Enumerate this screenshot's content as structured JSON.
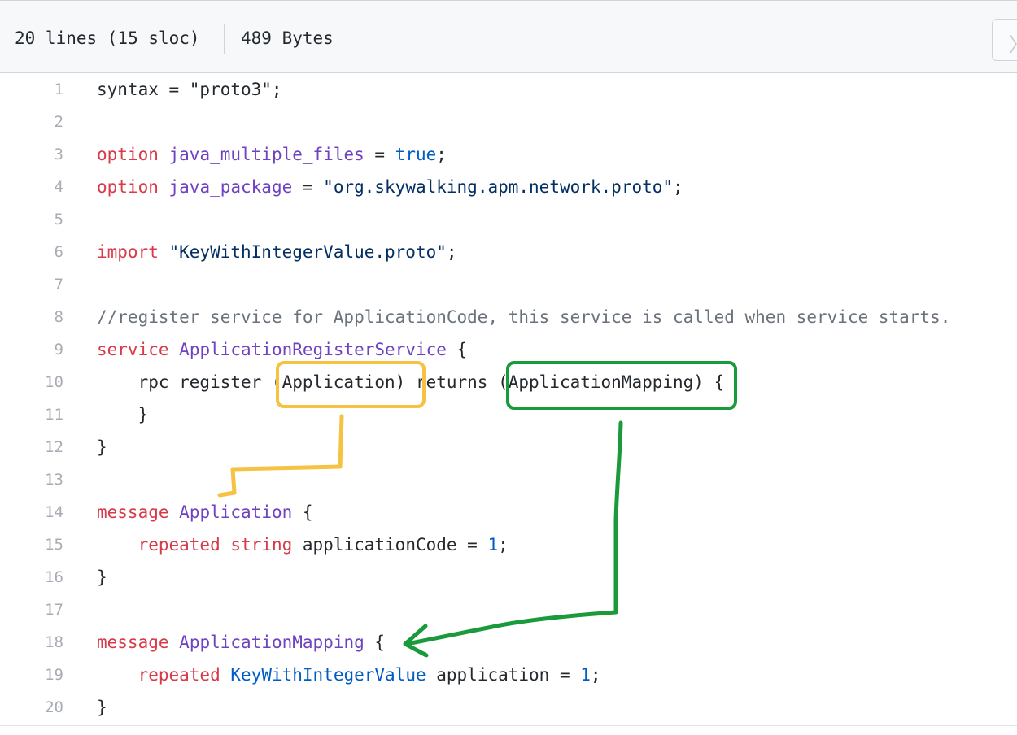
{
  "file_info": {
    "lines": "20 lines (15 sloc)",
    "size": "489 Bytes",
    "button_glyph": "〉"
  },
  "code_lines": [
    {
      "n": "1",
      "tokens": [
        {
          "t": "syntax = \"proto3\";",
          "c": "plain"
        }
      ]
    },
    {
      "n": "2",
      "tokens": []
    },
    {
      "n": "3",
      "tokens": [
        {
          "t": "option",
          "c": "kw"
        },
        {
          "t": " ",
          "c": "plain"
        },
        {
          "t": "java_multiple_files",
          "c": "ent"
        },
        {
          "t": " = ",
          "c": "plain"
        },
        {
          "t": "true",
          "c": "con"
        },
        {
          "t": ";",
          "c": "plain"
        }
      ]
    },
    {
      "n": "4",
      "tokens": [
        {
          "t": "option",
          "c": "kw"
        },
        {
          "t": " ",
          "c": "plain"
        },
        {
          "t": "java_package",
          "c": "ent"
        },
        {
          "t": " = ",
          "c": "plain"
        },
        {
          "t": "\"org.skywalking.apm.network.proto\"",
          "c": "str"
        },
        {
          "t": ";",
          "c": "plain"
        }
      ]
    },
    {
      "n": "5",
      "tokens": []
    },
    {
      "n": "6",
      "tokens": [
        {
          "t": "import",
          "c": "kw"
        },
        {
          "t": " ",
          "c": "plain"
        },
        {
          "t": "\"KeyWithIntegerValue.proto\"",
          "c": "str"
        },
        {
          "t": ";",
          "c": "plain"
        }
      ]
    },
    {
      "n": "7",
      "tokens": []
    },
    {
      "n": "8",
      "tokens": [
        {
          "t": "//register service for ApplicationCode, this service is called when service starts.",
          "c": "cmt"
        }
      ]
    },
    {
      "n": "9",
      "tokens": [
        {
          "t": "service",
          "c": "kw"
        },
        {
          "t": " ",
          "c": "plain"
        },
        {
          "t": "ApplicationRegisterService",
          "c": "ent"
        },
        {
          "t": " {",
          "c": "plain"
        }
      ]
    },
    {
      "n": "10",
      "tokens": [
        {
          "t": "    rpc register (Application) returns (ApplicationMapping) {",
          "c": "plain"
        }
      ]
    },
    {
      "n": "11",
      "tokens": [
        {
          "t": "    }",
          "c": "plain"
        }
      ]
    },
    {
      "n": "12",
      "tokens": [
        {
          "t": "}",
          "c": "plain"
        }
      ]
    },
    {
      "n": "13",
      "tokens": []
    },
    {
      "n": "14",
      "tokens": [
        {
          "t": "message",
          "c": "kw"
        },
        {
          "t": " ",
          "c": "plain"
        },
        {
          "t": "Application",
          "c": "ent"
        },
        {
          "t": " {",
          "c": "plain"
        }
      ]
    },
    {
      "n": "15",
      "tokens": [
        {
          "t": "    ",
          "c": "plain"
        },
        {
          "t": "repeated",
          "c": "kw"
        },
        {
          "t": " ",
          "c": "plain"
        },
        {
          "t": "string",
          "c": "kw"
        },
        {
          "t": " applicationCode = ",
          "c": "plain"
        },
        {
          "t": "1",
          "c": "con"
        },
        {
          "t": ";",
          "c": "plain"
        }
      ]
    },
    {
      "n": "16",
      "tokens": [
        {
          "t": "}",
          "c": "plain"
        }
      ]
    },
    {
      "n": "17",
      "tokens": []
    },
    {
      "n": "18",
      "tokens": [
        {
          "t": "message",
          "c": "kw"
        },
        {
          "t": " ",
          "c": "plain"
        },
        {
          "t": "ApplicationMapping",
          "c": "ent"
        },
        {
          "t": " {",
          "c": "plain"
        }
      ]
    },
    {
      "n": "19",
      "tokens": [
        {
          "t": "    ",
          "c": "plain"
        },
        {
          "t": "repeated",
          "c": "kw"
        },
        {
          "t": " ",
          "c": "plain"
        },
        {
          "t": "KeyWithIntegerValue",
          "c": "con"
        },
        {
          "t": " application = ",
          "c": "plain"
        },
        {
          "t": "1",
          "c": "con"
        },
        {
          "t": ";",
          "c": "plain"
        }
      ]
    },
    {
      "n": "20",
      "tokens": [
        {
          "t": "}",
          "c": "plain"
        }
      ]
    }
  ],
  "annotations": {
    "request_color": "#f5c242",
    "response_color": "#1a9a3a"
  }
}
